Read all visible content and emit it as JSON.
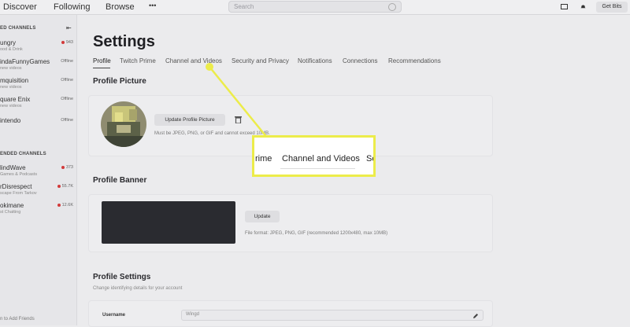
{
  "topbar": {
    "nav": [
      "Discover",
      "Following",
      "Browse"
    ],
    "more": "•••",
    "search_placeholder": "Search",
    "get_bits": "Get Bits"
  },
  "sidebar": {
    "followed_header": "ED CHANNELS",
    "recommended_header": "ENDED CHANNELS",
    "add_friends": "n to Add Friends",
    "followed": [
      {
        "name": "ungry",
        "sub": "ood & Drink",
        "status": "943",
        "live": true
      },
      {
        "name": "indaFunnyGames",
        "sub": "new videos",
        "status": "Offline",
        "live": false
      },
      {
        "name": "mquisition",
        "sub": "new videos",
        "status": "Offline",
        "live": false
      },
      {
        "name": "quare Enix",
        "sub": "new videos",
        "status": "Offline",
        "live": false
      },
      {
        "name": "intendo",
        "sub": "",
        "status": "Offline",
        "live": false
      }
    ],
    "recommended": [
      {
        "name": "lindWave",
        "sub": "Games & Podcasts",
        "status": "373",
        "live": true
      },
      {
        "name": "rDisrespect",
        "sub": "scape From Tarkov",
        "status": "55.7K",
        "live": true
      },
      {
        "name": "okimane",
        "sub": "st Chatting",
        "status": "12.6K",
        "live": true
      }
    ]
  },
  "page": {
    "title": "Settings",
    "tabs": [
      "Profile",
      "Twitch Prime",
      "Channel and Videos",
      "Security and Privacy",
      "Notifications",
      "Connections",
      "Recommendations"
    ]
  },
  "profile_picture": {
    "heading": "Profile Picture",
    "button": "Update Profile Picture",
    "hint": "Must be JPEG, PNG, or GIF and cannot exceed 10MB."
  },
  "profile_banner": {
    "heading": "Profile Banner",
    "button": "Update",
    "hint": "File format: JPEG, PNG, GIF (recommended 1200x480, max 10MB)"
  },
  "profile_settings": {
    "heading": "Profile Settings",
    "subtitle": "Change identifying details for your account",
    "username_label": "Username",
    "username_value": "Wingd"
  },
  "callout": {
    "left": "rime",
    "center": "Channel and Videos",
    "right": "Se"
  }
}
